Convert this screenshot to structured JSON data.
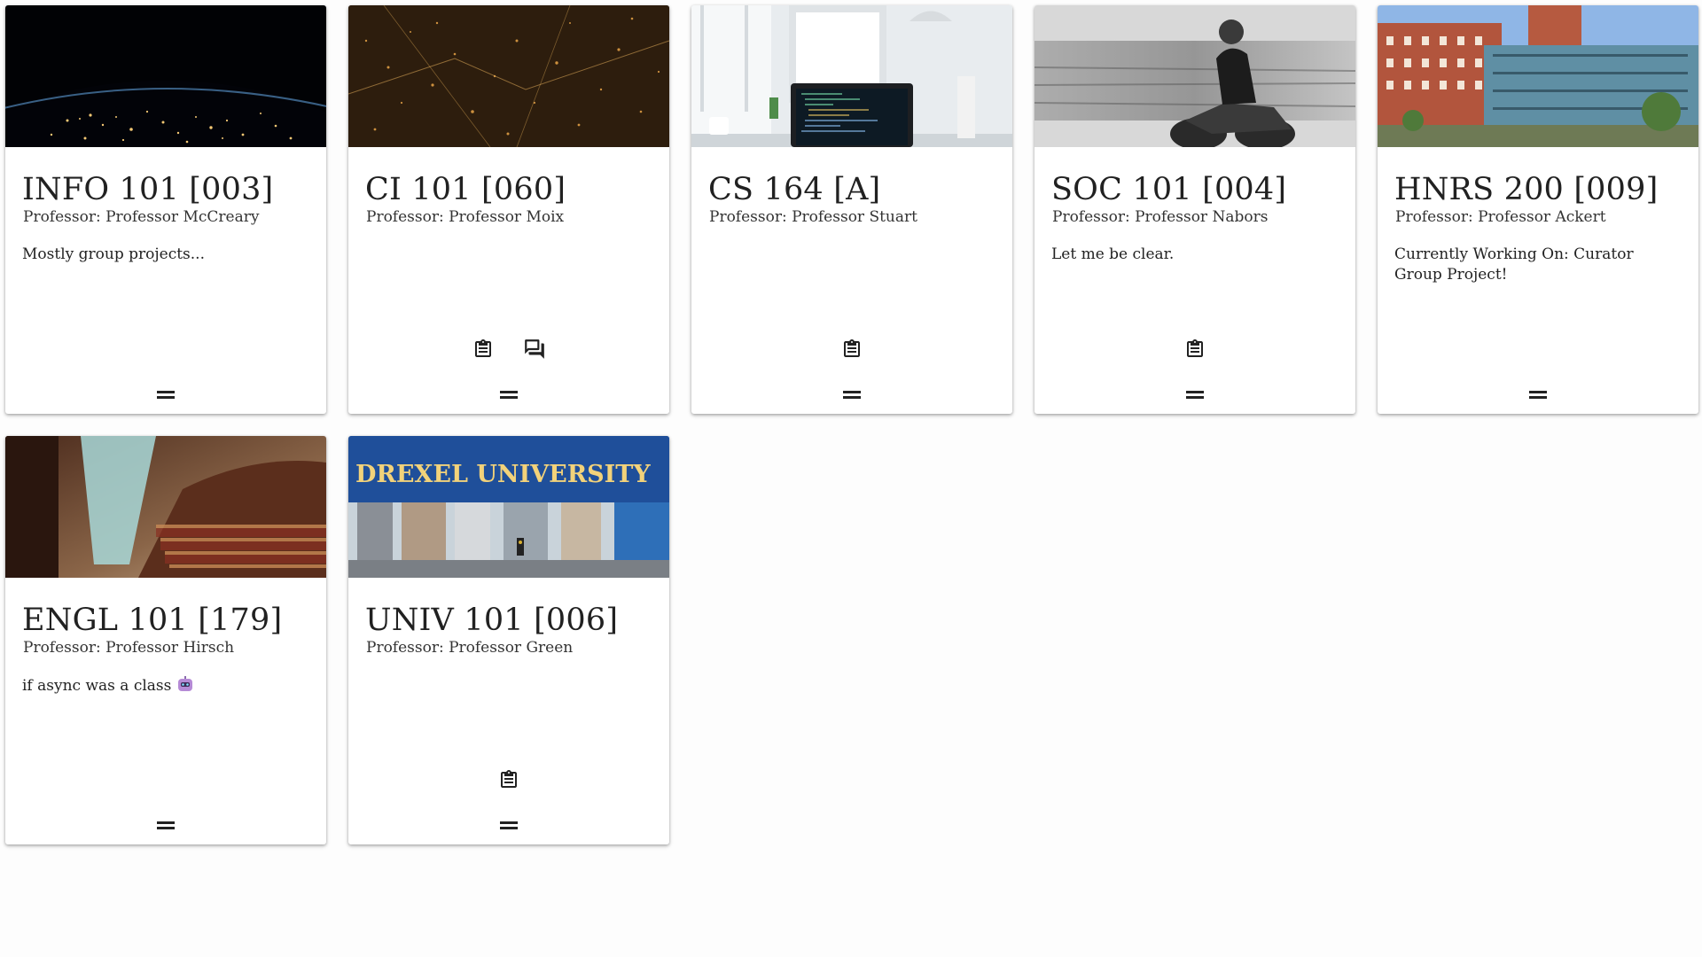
{
  "page": {
    "background": "#fdfdfd"
  },
  "courses": [
    {
      "title": "INFO 101 [003]",
      "professor": "Professor: Professor McCreary",
      "description": "Mostly group projects...",
      "image": "earth-at-night",
      "actions": []
    },
    {
      "title": "CI 101 [060]",
      "professor": "Professor: Professor Moix",
      "description": "",
      "image": "city-lights-aerial",
      "actions": [
        "assignment-icon",
        "forum-icon"
      ]
    },
    {
      "title": "CS 164 [A]",
      "professor": "Professor: Professor Stuart",
      "description": "",
      "image": "desk-laptop-code",
      "actions": [
        "assignment-icon"
      ]
    },
    {
      "title": "SOC 101 [004]",
      "professor": "Professor: Professor Nabors",
      "description": "Let me be clear.",
      "image": "motorcycle-rider-bw",
      "actions": [
        "assignment-icon"
      ]
    },
    {
      "title": "HNRS 200 [009]",
      "professor": "Professor: Professor Ackert",
      "description": "Currently Working On: Curator Group Project!",
      "image": "brick-building",
      "actions": []
    },
    {
      "title": "ENGL 101 [179]",
      "professor": "Professor: Professor Hirsch",
      "description": "if async was a class",
      "description_emoji": "robot-emoji",
      "image": "library-bookshelves",
      "actions": []
    },
    {
      "title": "UNIV 101 [006]",
      "professor": "Professor: Professor Green",
      "description": "",
      "image": "drexel-university-bridge",
      "image_text": "DREXEL UNIVERSITY",
      "actions": [
        "assignment-icon"
      ]
    }
  ]
}
